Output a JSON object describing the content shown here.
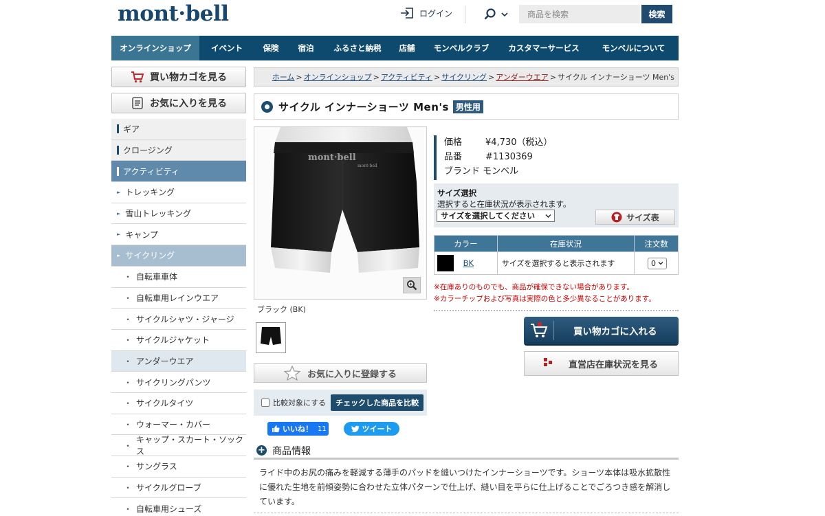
{
  "header": {
    "logo": "mont·bell",
    "login_label": "ログイン",
    "search_placeholder": "商品を検索",
    "search_button": "検索"
  },
  "nav": [
    {
      "label": "オンラインショップ",
      "active": true
    },
    {
      "label": "イベント"
    },
    {
      "label": "保険"
    },
    {
      "label": "宿泊"
    },
    {
      "label": "ふるさと納税"
    },
    {
      "label": "店舗"
    },
    {
      "label": "モンベルクラブ"
    },
    {
      "label": "カスタマーサービス"
    },
    {
      "label": "モンベルについて"
    }
  ],
  "sidebar": {
    "cart_button": "買い物カゴを見る",
    "favorites_button": "お気に入りを見る",
    "menu": [
      {
        "label": "ギア",
        "level": 0
      },
      {
        "label": "クロージング",
        "level": 0
      },
      {
        "label": "アクティビティ",
        "level": 0,
        "active": true
      },
      {
        "label": "トレッキング",
        "level": 1
      },
      {
        "label": "雪山トレッキング",
        "level": 1
      },
      {
        "label": "キャンプ",
        "level": 1
      },
      {
        "label": "サイクリング",
        "level": 1,
        "active": true
      },
      {
        "label": "自転車車体",
        "level": 2
      },
      {
        "label": "自転車用レインウエア",
        "level": 2
      },
      {
        "label": "サイクルシャツ・ジャージ",
        "level": 2
      },
      {
        "label": "サイクルジャケット",
        "level": 2
      },
      {
        "label": "アンダーウエア",
        "level": 2,
        "active": true
      },
      {
        "label": "サイクリングパンツ",
        "level": 2
      },
      {
        "label": "サイクルタイツ",
        "level": 2
      },
      {
        "label": "ウォーマー・カバー",
        "level": 2
      },
      {
        "label": "キャップ・スカート・ソックス",
        "level": 2
      },
      {
        "label": "サングラス",
        "level": 2
      },
      {
        "label": "サイクルグローブ",
        "level": 2
      },
      {
        "label": "自転車用シューズ",
        "level": 2
      }
    ]
  },
  "breadcrumb": [
    {
      "label": "ホーム",
      "link": true
    },
    {
      "label": "オンラインショップ",
      "link": true
    },
    {
      "label": "アクティビティ",
      "link": true
    },
    {
      "label": "サイクリング",
      "link": true
    },
    {
      "label": "アンダーウエア",
      "link": true,
      "visited": true
    },
    {
      "label": "サイクル インナーショーツ Men's",
      "link": false
    }
  ],
  "product": {
    "title": "サイクル インナーショーツ Men's",
    "gender_badge": "男性用",
    "image_logo": "mont·bell",
    "color_caption": "ブラック (BK)",
    "price_label": "価格",
    "price_value": "¥4,730（税込）",
    "sku_label": "品番",
    "sku_value": "#1130369",
    "brand_label": "ブランド",
    "brand_value": "モンベル",
    "favorite_button": "お気に入りに登録する",
    "compare_label": "比較対象にする",
    "compare_button": "チェックした商品を比較",
    "like_label": "いいね！",
    "like_count": "11",
    "tweet_label": "ツイート"
  },
  "size": {
    "heading": "サイズ選択",
    "hint": "選択すると在庫状況が表示されます。",
    "select_value": "サイズを選択してください",
    "chart_button": "サイズ表"
  },
  "stock_table": {
    "headers": [
      "カラー",
      "在庫状況",
      "注文数"
    ],
    "rows": [
      {
        "swatch_color": "#000000",
        "code": "BK",
        "status": "サイズを選択すると表示されます",
        "qty": "0"
      }
    ]
  },
  "notes": [
    "※在庫ありのものでも、商品が確保できない場合があります。",
    "※カラーチップおよび写真は実際の色と多少異なることがあります。"
  ],
  "actions": {
    "add_to_cart": "買い物カゴに入れる",
    "store_stock": "直営店在庫状況を見る"
  },
  "product_info": {
    "heading": "商品情報",
    "body": "ライド中のお尻の痛みを軽減する薄手のパッドを縫いつけたインナーショーツです。ショーツ本体は吸水拡散性に優れた生地を前傾姿勢に合わせた立体パターンで仕上げ、縫い目を平らに仕上げることでごろつき感を解消しています。"
  },
  "colors": {
    "brand_navy": "#0e4a6e",
    "nav_active": "#3b7594",
    "warning_red": "#d00000"
  }
}
